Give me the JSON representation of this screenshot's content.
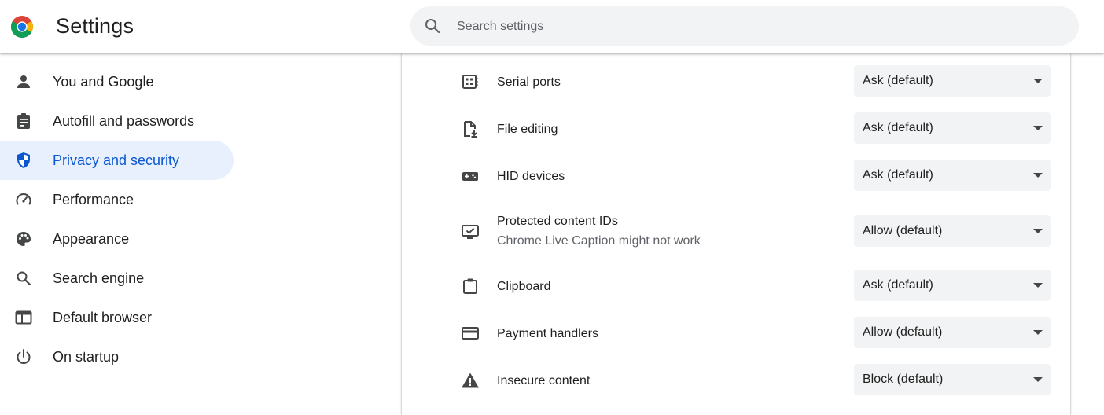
{
  "app": {
    "title": "Settings"
  },
  "search": {
    "placeholder": "Search settings"
  },
  "sidebar": {
    "items": [
      {
        "label": "You and Google",
        "icon": "person-icon",
        "active": false
      },
      {
        "label": "Autofill and passwords",
        "icon": "clipboard-list-icon",
        "active": false
      },
      {
        "label": "Privacy and security",
        "icon": "shield-icon",
        "active": true
      },
      {
        "label": "Performance",
        "icon": "speedometer-icon",
        "active": false
      },
      {
        "label": "Appearance",
        "icon": "palette-icon",
        "active": false
      },
      {
        "label": "Search engine",
        "icon": "search-icon",
        "active": false
      },
      {
        "label": "Default browser",
        "icon": "browser-window-icon",
        "active": false
      },
      {
        "label": "On startup",
        "icon": "power-icon",
        "active": false
      }
    ]
  },
  "permissions": [
    {
      "label": "Serial ports",
      "icon": "serial-port-icon",
      "value": "Ask (default)"
    },
    {
      "label": "File editing",
      "icon": "file-edit-icon",
      "value": "Ask (default)"
    },
    {
      "label": "HID devices",
      "icon": "gamepad-icon",
      "value": "Ask (default)"
    },
    {
      "label": "Protected content IDs",
      "sublabel": "Chrome Live Caption might not work",
      "icon": "monitor-check-icon",
      "value": "Allow (default)"
    },
    {
      "label": "Clipboard",
      "icon": "clipboard-icon",
      "value": "Ask (default)"
    },
    {
      "label": "Payment handlers",
      "icon": "credit-card-icon",
      "value": "Allow (default)"
    },
    {
      "label": "Insecure content",
      "icon": "warning-icon",
      "value": "Block (default)"
    }
  ],
  "colors": {
    "accent": "#0b57d0",
    "active_bg": "#e8f0fe",
    "search_bg": "#f1f3f4",
    "icon": "#444746"
  }
}
